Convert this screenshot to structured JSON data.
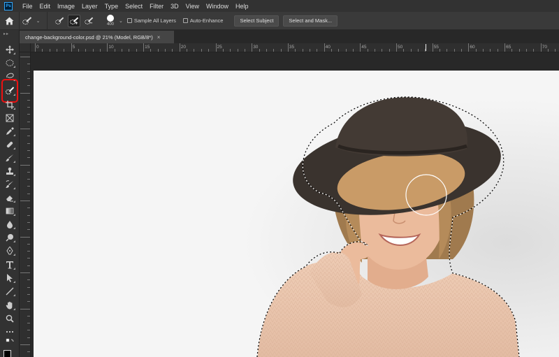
{
  "app": {
    "logo_text": "Ps",
    "menu": [
      "File",
      "Edit",
      "Image",
      "Layer",
      "Type",
      "Select",
      "Filter",
      "3D",
      "View",
      "Window",
      "Help"
    ]
  },
  "options": {
    "brush_size": "400",
    "sample_all_layers": "Sample All Layers",
    "auto_enhance": "Auto-Enhance",
    "select_subject": "Select Subject",
    "select_and_mask": "Select and Mask..."
  },
  "document": {
    "tab_title": "change-background-color.psd @ 21% (Model, RGB/8*)"
  },
  "ruler": {
    "labels": [
      "0",
      "5",
      "10",
      "15",
      "20",
      "25",
      "30",
      "35",
      "40",
      "45",
      "50",
      "55",
      "60",
      "65",
      "70"
    ]
  },
  "tools": [
    {
      "name": "move-tool-icon"
    },
    {
      "name": "lasso-marquee-tool-icon"
    },
    {
      "name": "lasso-tool-icon"
    },
    {
      "name": "quick-selection-tool-icon"
    },
    {
      "name": "crop-tool-icon"
    },
    {
      "name": "frame-tool-icon"
    },
    {
      "name": "eyedropper-tool-icon"
    },
    {
      "name": "healing-brush-tool-icon"
    },
    {
      "name": "brush-tool-icon"
    },
    {
      "name": "clone-stamp-tool-icon"
    },
    {
      "name": "history-brush-tool-icon"
    },
    {
      "name": "eraser-tool-icon"
    },
    {
      "name": "gradient-tool-icon"
    },
    {
      "name": "blur-tool-icon"
    },
    {
      "name": "dodge-tool-icon"
    },
    {
      "name": "pen-tool-icon"
    },
    {
      "name": "type-tool-icon"
    },
    {
      "name": "path-selection-tool-icon"
    },
    {
      "name": "line-tool-icon"
    },
    {
      "name": "hand-tool-icon"
    },
    {
      "name": "zoom-tool-icon"
    },
    {
      "name": "more-tools-icon"
    }
  ],
  "colors": {
    "highlight": "#e11111",
    "canvas_bg": "#f5f5f5",
    "hat": "#3a332e",
    "sweater": "#e8c5ad",
    "skin": "#e9b89a",
    "hair": "#b58b5a"
  }
}
